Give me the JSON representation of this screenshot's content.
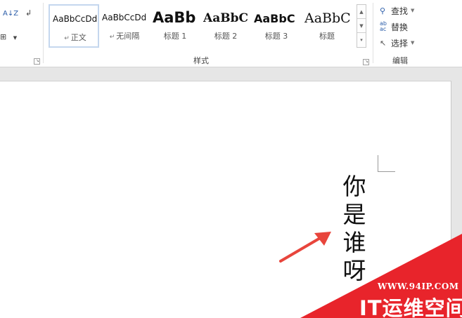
{
  "ribbon": {
    "paragraph": {
      "sort_label": "A↓Z",
      "pilcrow_label": "↲",
      "border_label": "⊞"
    },
    "styles": {
      "group_label": "样式",
      "items": [
        {
          "preview": "AaBbCcDd",
          "name": "正文",
          "marker": "↵",
          "selected": true
        },
        {
          "preview": "AaBbCcDd",
          "name": "无间隔",
          "marker": "↵",
          "selected": false
        },
        {
          "preview": "AaBb",
          "name": "标题 1",
          "marker": "",
          "selected": false
        },
        {
          "preview": "AaBbC",
          "name": "标题 2",
          "marker": "",
          "selected": false
        },
        {
          "preview": "AaBbC",
          "name": "标题 3",
          "marker": "",
          "selected": false
        },
        {
          "preview": "AaBbC",
          "name": "标题",
          "marker": "",
          "selected": false
        }
      ]
    },
    "editing": {
      "group_label": "编辑",
      "find_label": "查找",
      "replace_label": "替换",
      "select_label": "选择"
    }
  },
  "document": {
    "vertical_text": "你是谁呀"
  },
  "watermark": {
    "url": "WWW.94IP.COM",
    "title": "IT运维空间"
  },
  "colors": {
    "accent": "#2a5ca8",
    "arrow": "#e8453c",
    "watermark_red": "#e8242b",
    "selected_border": "#c5d7ee"
  }
}
